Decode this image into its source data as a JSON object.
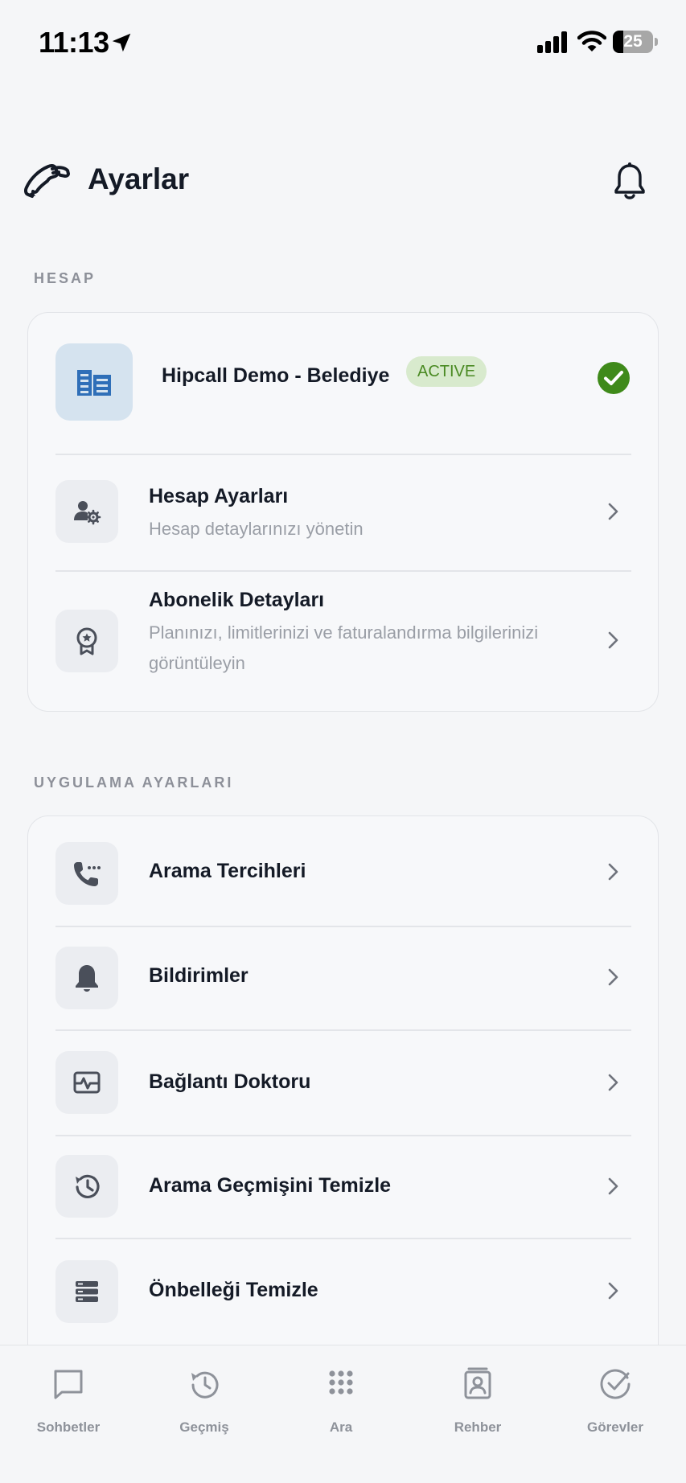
{
  "status_bar": {
    "time": "11:13",
    "battery": "25",
    "battery_level": 0.25,
    "icons": [
      "location-arrow-icon",
      "cellular-signal-icon",
      "wifi-icon",
      "battery-icon"
    ]
  },
  "header": {
    "title": "Ayarlar",
    "logo_icon": "phone-handset-icon",
    "notification_icon": "bell-icon"
  },
  "sections": {
    "account": {
      "label": "HESAP",
      "company": {
        "name": "Hipcall Demo - Belediye",
        "badge": "ACTIVE",
        "icon": "building-icon",
        "status_icon": "check-circle-icon"
      },
      "items": [
        {
          "title": "Hesap Ayarları",
          "subtitle": "Hesap detaylarınızı yönetin",
          "icon": "user-settings-icon"
        },
        {
          "title": "Abonelik Detayları",
          "subtitle": "Planınızı, limitlerinizi ve faturalandırma bilgilerinizi görüntüleyin",
          "icon": "award-badge-icon"
        }
      ]
    },
    "app": {
      "label": "UYGULAMA AYARLARI",
      "items": [
        {
          "title": "Arama Tercihleri",
          "icon": "phone-dots-icon"
        },
        {
          "title": "Bildirimler",
          "icon": "bell-icon"
        },
        {
          "title": "Bağlantı Doktoru",
          "icon": "pulse-monitor-icon"
        },
        {
          "title": "Arama Geçmişini Temizle",
          "icon": "history-icon"
        },
        {
          "title": "Önbelleği Temizle",
          "icon": "storage-stack-icon"
        }
      ]
    }
  },
  "tab_bar": {
    "tabs": [
      {
        "label": "Sohbetler",
        "icon": "chat-bubble-icon"
      },
      {
        "label": "Geçmiş",
        "icon": "history-icon"
      },
      {
        "label": "Ara",
        "icon": "dialpad-icon"
      },
      {
        "label": "Rehber",
        "icon": "contact-book-icon"
      },
      {
        "label": "Görevler",
        "icon": "check-circle-icon"
      }
    ]
  },
  "colors": {
    "background": "#f5f6f8",
    "text_primary": "#141a26",
    "text_secondary": "#9a9ea6",
    "badge_bg": "#d8eacd",
    "badge_text": "#4a8a23",
    "check_green": "#3f8a1a",
    "building_blue": "#2f6fb8",
    "tab_inactive": "#8e929a"
  }
}
